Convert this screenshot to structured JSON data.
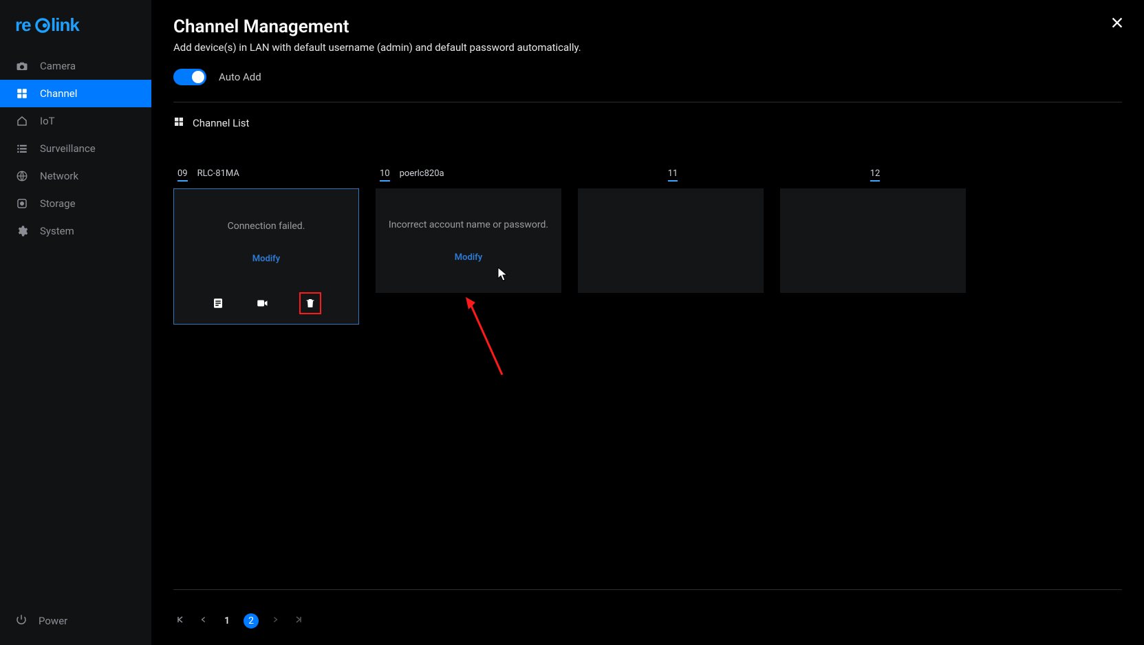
{
  "brand": "reolink",
  "sidebar": {
    "items": [
      {
        "label": "Camera"
      },
      {
        "label": "Channel"
      },
      {
        "label": "IoT"
      },
      {
        "label": "Surveillance"
      },
      {
        "label": "Network"
      },
      {
        "label": "Storage"
      },
      {
        "label": "System"
      }
    ],
    "power_label": "Power"
  },
  "header": {
    "title": "Channel Management",
    "subtitle": "Add device(s) in LAN with default username (admin) and default password automatically."
  },
  "toggle": {
    "label": "Auto Add",
    "on": true
  },
  "section": {
    "title": "Channel List"
  },
  "channels": [
    {
      "num": "09",
      "name": "RLC-81MA",
      "status": "Connection failed.",
      "modify": "Modify",
      "highlight": true,
      "show_actions": true
    },
    {
      "num": "10",
      "name": "poerlc820a",
      "status": "Incorrect account name or password.",
      "modify": "Modify",
      "highlight": false,
      "show_actions": false
    },
    {
      "num": "11",
      "name": "",
      "status": "",
      "modify": "",
      "highlight": false,
      "show_actions": false
    },
    {
      "num": "12",
      "name": "",
      "status": "",
      "modify": "",
      "highlight": false,
      "show_actions": false
    }
  ],
  "pager": {
    "first": "K",
    "prev": "‹",
    "pages": [
      "1",
      "2"
    ],
    "active_index": 1,
    "next": "›",
    "last": "›|"
  }
}
